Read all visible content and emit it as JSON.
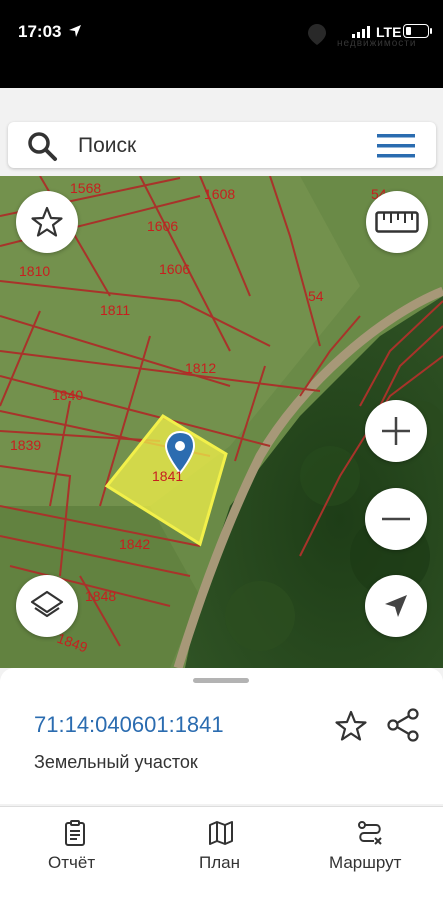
{
  "status_bar": {
    "time": "17:03",
    "network": "LTE",
    "battery_level": 0.25,
    "watermark": "недвижимости"
  },
  "search": {
    "placeholder": "Поиск"
  },
  "map": {
    "parcels": [
      {
        "label": "1568"
      },
      {
        "label": "1608"
      },
      {
        "label": "54"
      },
      {
        "label": "1606"
      },
      {
        "label": "1606"
      },
      {
        "label": "1810"
      },
      {
        "label": "1811"
      },
      {
        "label": "54"
      },
      {
        "label": "1812"
      },
      {
        "label": "1840"
      },
      {
        "label": "1839"
      },
      {
        "label": "1841"
      },
      {
        "label": "1842"
      },
      {
        "label": "1848"
      },
      {
        "label": "1849"
      }
    ],
    "selected_parcel": "1841",
    "highlight_color": "#f2f04a"
  },
  "map_controls": {
    "favorite": "star-icon",
    "ruler": "ruler-icon",
    "zoom_in": "plus-icon",
    "zoom_out": "minus-icon",
    "layers": "layers-icon",
    "locate": "locate-arrow-icon"
  },
  "sheet": {
    "cadastral_number": "71:14:040601:1841",
    "object_type": "Земельный участок"
  },
  "tabs": [
    {
      "label": "Отчёт",
      "icon": "report-icon"
    },
    {
      "label": "План",
      "icon": "map-plan-icon"
    },
    {
      "label": "Маршрут",
      "icon": "route-icon"
    }
  ],
  "colors": {
    "accent": "#2b6cb0",
    "menu_icon": "#2b6cb0",
    "parcel_border": "#a8332a",
    "parcel_label": "#c71f1f"
  }
}
